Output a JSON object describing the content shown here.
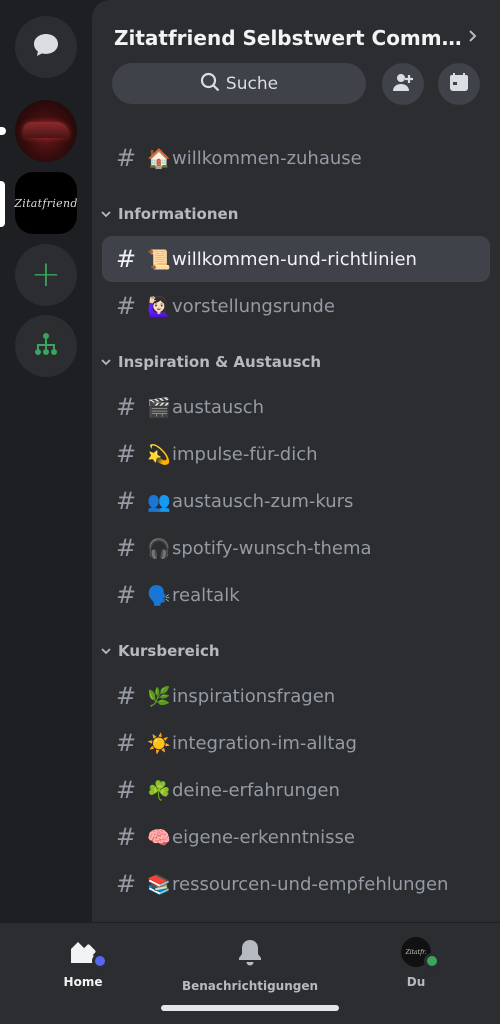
{
  "server": {
    "title": "Zitatfriend Selbstwert Commun...",
    "search_label": "Suche"
  },
  "rail": {
    "server2_logo_text": "Zitatfriend",
    "add_label": "+"
  },
  "channels": {
    "top": [
      {
        "emoji": "🏠",
        "name": "willkommen-zuhause"
      }
    ],
    "categories": [
      {
        "label": "Informationen",
        "items": [
          {
            "emoji": "📜",
            "name": "willkommen-und-richtlinien",
            "active": true
          },
          {
            "emoji": "🙋🏻‍♀️",
            "name": "vorstellungsrunde"
          }
        ]
      },
      {
        "label": "Inspiration & Austausch",
        "items": [
          {
            "emoji": "🎬",
            "name": "austausch"
          },
          {
            "emoji": "💫",
            "name": "impulse-für-dich"
          },
          {
            "emoji": "👥",
            "name": "austausch-zum-kurs"
          },
          {
            "emoji": "🎧",
            "name": "spotify-wunsch-thema"
          },
          {
            "emoji": "🗣️",
            "name": "realtalk"
          }
        ]
      },
      {
        "label": "Kursbereich",
        "items": [
          {
            "emoji": "🌿",
            "name": "inspirationsfragen"
          },
          {
            "emoji": "☀️",
            "name": "integration-im-alltag"
          },
          {
            "emoji": "☘️",
            "name": "deine-erfahrungen"
          },
          {
            "emoji": "🧠",
            "name": "eigene-erkenntnisse"
          },
          {
            "emoji": "📚",
            "name": "ressourcen-und-empfehlungen"
          }
        ]
      }
    ]
  },
  "tabbar": {
    "home": "Home",
    "notifications": "Benachrichtigungen",
    "you": "Du",
    "avatar_text": "Zitatfr."
  },
  "colors": {
    "accent": "#5865f2",
    "online": "#3ba55d",
    "panel": "#2b2d31",
    "rail": "#1e1f22"
  }
}
